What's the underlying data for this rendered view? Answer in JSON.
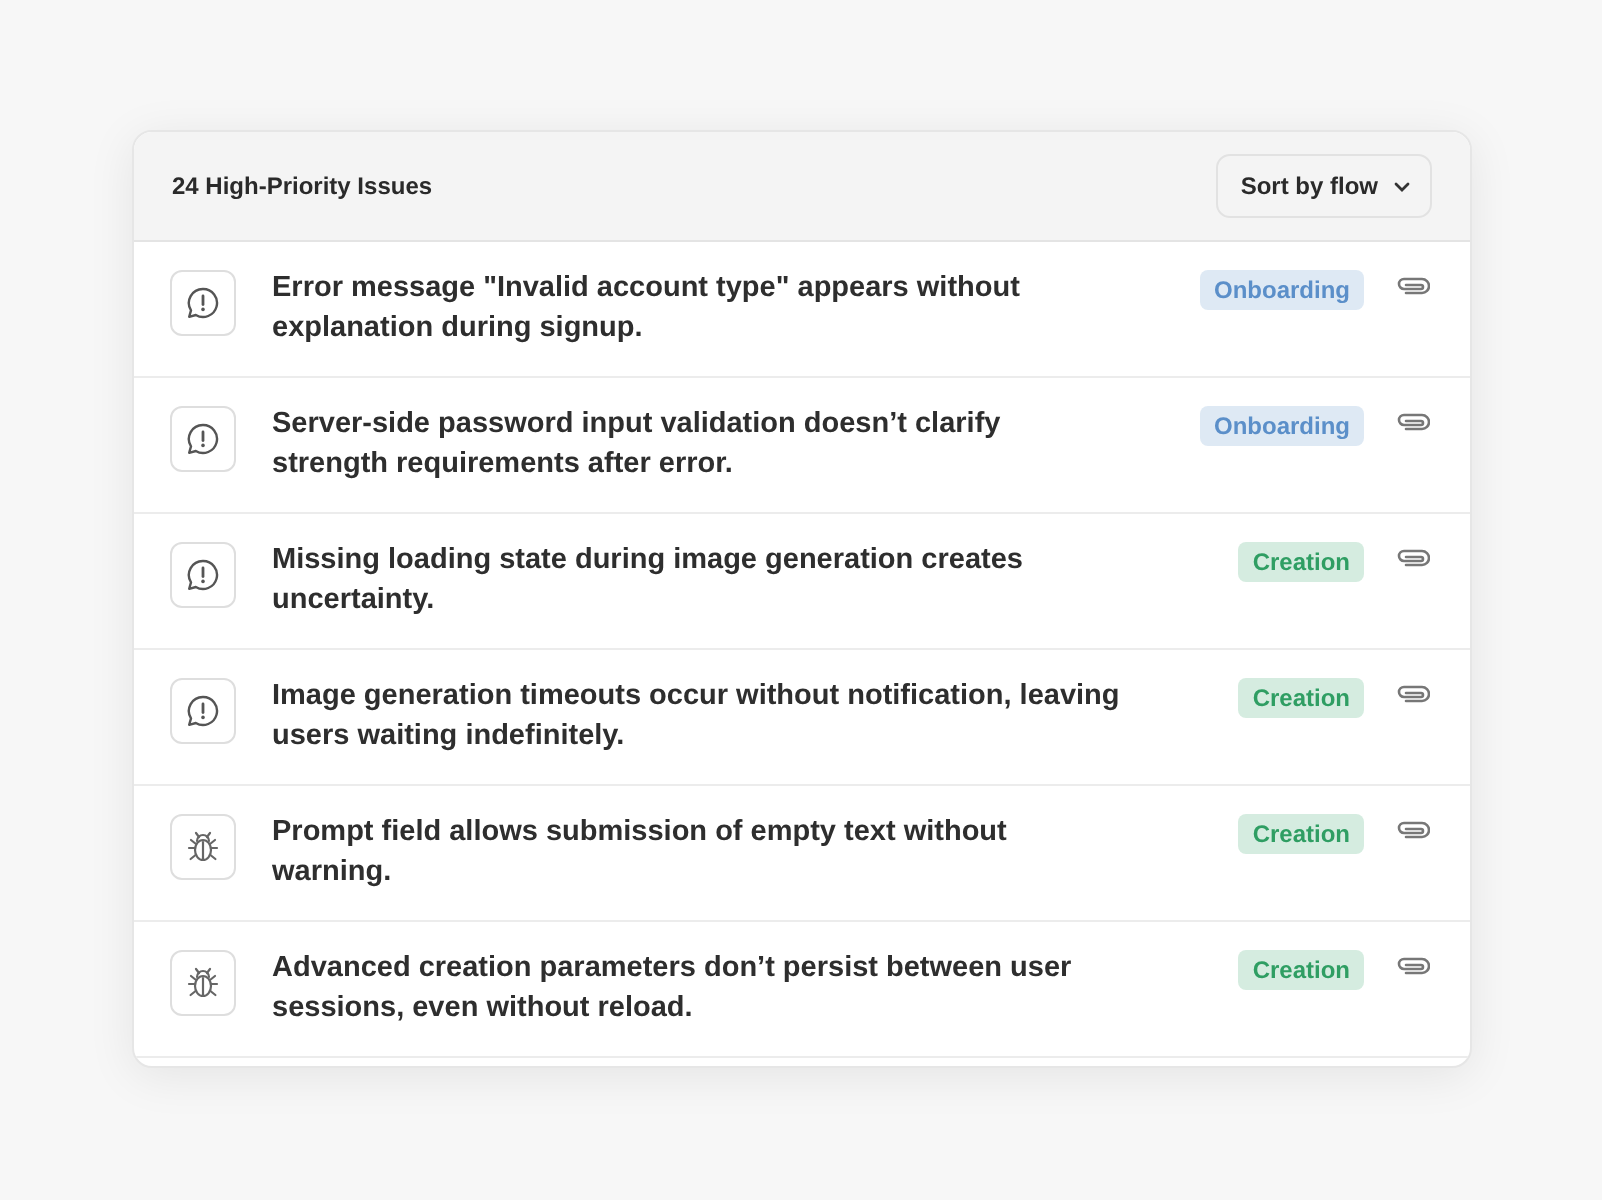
{
  "header": {
    "title": "24 High-Priority Issues",
    "sort_button": "Sort by flow"
  },
  "issues": [
    {
      "kind": "alert",
      "text": "Error message \"Invalid account type\" appears without explanation during signup.",
      "tag": "Onboarding",
      "color": "#5b8fc9"
    },
    {
      "kind": "alert",
      "text": "Server-side password input validation doesn’t clarify strength requirements after error.",
      "tag": "Onboarding",
      "color": "#5b8fc9"
    },
    {
      "kind": "alert",
      "text": "Missing loading state during image generation creates uncertainty.",
      "tag": "Creation",
      "color": "#2f9e63"
    },
    {
      "kind": "alert",
      "text": "Image generation timeouts occur without notification, leaving users waiting indefinitely.",
      "tag": "Creation",
      "color": "#2f9e63"
    },
    {
      "kind": "bug",
      "text": "Prompt field allows submission of empty text without warning.",
      "tag": "Creation",
      "color": "#2f9e63"
    },
    {
      "kind": "bug",
      "text": "Advanced creation parameters don’t persist between user sessions, even without reload.",
      "tag": "Creation",
      "color": "#2f9e63"
    }
  ]
}
